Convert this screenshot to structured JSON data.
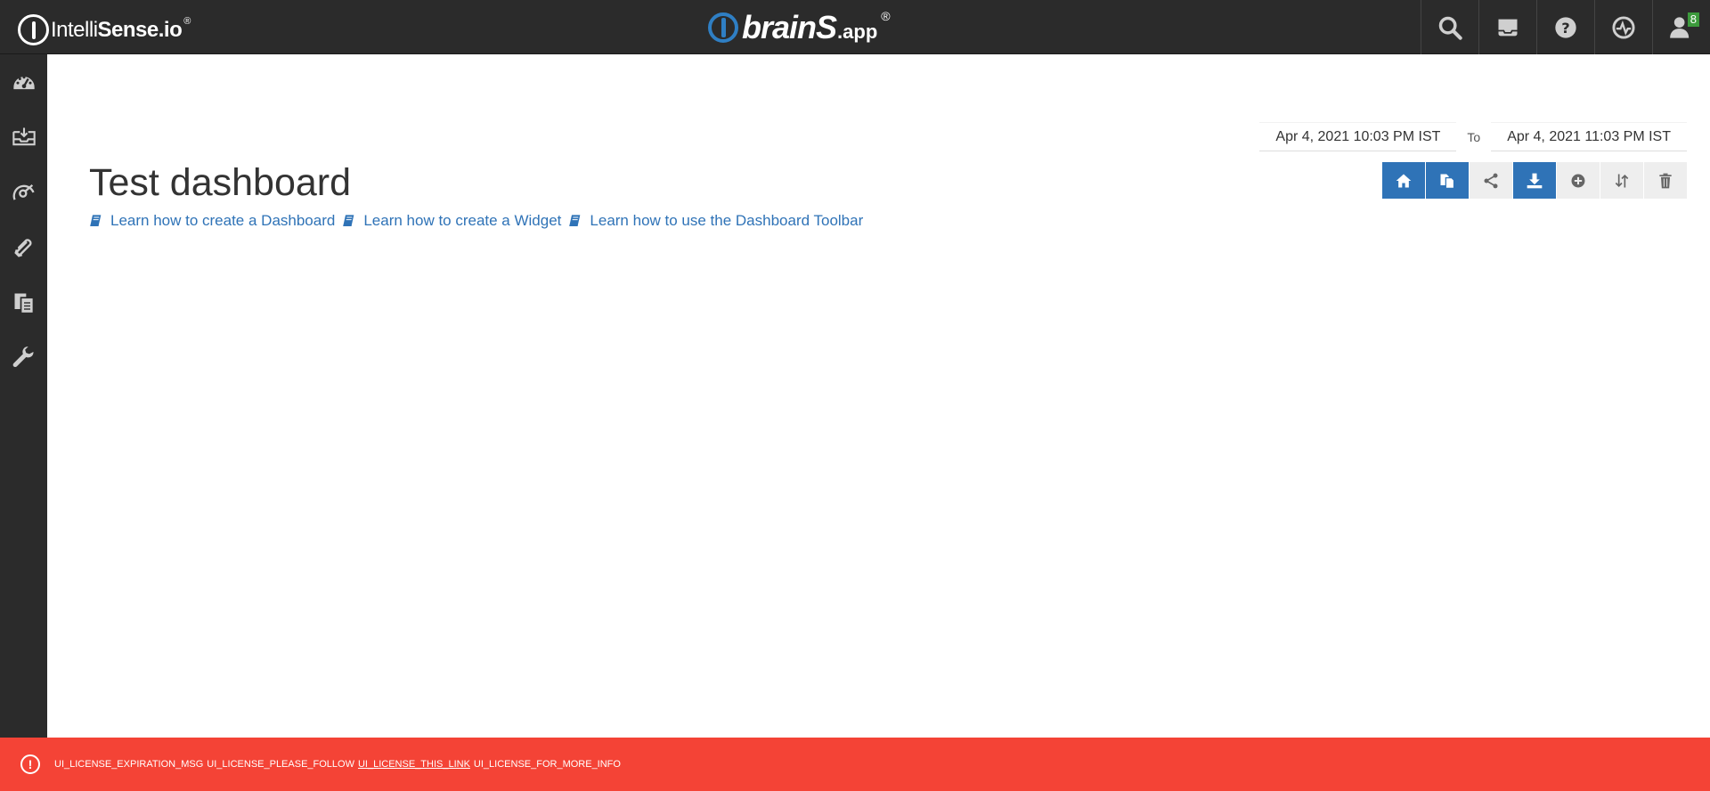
{
  "header": {
    "brand_left": {
      "prefix": "Intelli",
      "bold": "Sense.io",
      "reg": "®"
    },
    "brand_center": {
      "main": "brain",
      "tail": "S",
      "small": ".app",
      "reg": "®"
    },
    "notification_count": "8",
    "icons": [
      "search-icon",
      "inbox-icon",
      "help-icon",
      "dashboard-gauge-icon",
      "user-icon"
    ]
  },
  "sidebar": {
    "items": [
      "dashboard-icon",
      "inbox-download-icon",
      "gauge-icon",
      "attachment-icon",
      "documents-icon",
      "wrench-icon"
    ]
  },
  "date_range": {
    "from": "Apr 4, 2021 10:03 PM IST",
    "to_label": "To",
    "to": "Apr 4, 2021 11:03 PM IST"
  },
  "page": {
    "title": "Test dashboard",
    "links": [
      "Learn how to create a Dashboard",
      "Learn how to create a Widget",
      "Learn how to use the Dashboard Toolbar"
    ]
  },
  "toolbar": {
    "buttons": [
      "home-icon",
      "copy-icon",
      "share-icon",
      "download-icon",
      "add-icon",
      "sort-icon",
      "trash-icon"
    ]
  },
  "alert": {
    "msg1": "UI_LICENSE_EXPIRATION_MSG",
    "msg2": "UI_LICENSE_PLEASE_FOLLOW",
    "link": "UI_LICENSE_THIS_LINK",
    "msg3": "UI_LICENSE_FOR_MORE_INFO",
    "color": "#f44336"
  },
  "colors": {
    "topbar": "#2b2b2b",
    "accent": "#2f73b7",
    "brand_blue": "#2f7fc4"
  }
}
